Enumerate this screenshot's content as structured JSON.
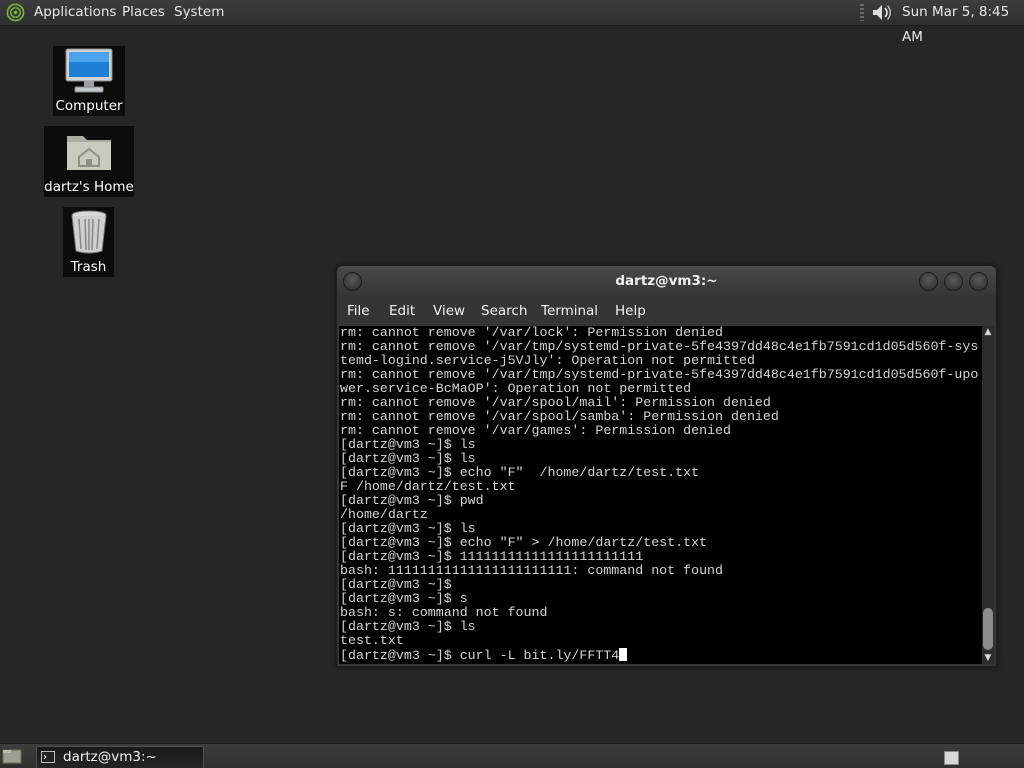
{
  "top_panel": {
    "menus": [
      "Applications",
      "Places",
      "System"
    ],
    "clock": "Sun Mar  5,  8:45 AM"
  },
  "desktop": {
    "icons": [
      {
        "label": "Computer",
        "icon": "computer-icon"
      },
      {
        "label": "dartz's Home",
        "icon": "home-folder-icon"
      },
      {
        "label": "Trash",
        "icon": "trash-icon"
      }
    ]
  },
  "terminal": {
    "title": "dartz@vm3:~",
    "menu": [
      "File",
      "Edit",
      "View",
      "Search",
      "Terminal",
      "Help"
    ],
    "lines": [
      "rm: cannot remove '/var/lock': Permission denied",
      "rm: cannot remove '/var/tmp/systemd-private-5fe4397dd48c4e1fb7591cd1d05d560f-sys",
      "temd-logind.service-j5VJly': Operation not permitted",
      "rm: cannot remove '/var/tmp/systemd-private-5fe4397dd48c4e1fb7591cd1d05d560f-upo",
      "wer.service-BcMaOP': Operation not permitted",
      "rm: cannot remove '/var/spool/mail': Permission denied",
      "rm: cannot remove '/var/spool/samba': Permission denied",
      "rm: cannot remove '/var/games': Permission denied",
      "[dartz@vm3 ~]$ ls",
      "[dartz@vm3 ~]$ ls",
      "[dartz@vm3 ~]$ echo \"F\"  /home/dartz/test.txt",
      "F /home/dartz/test.txt",
      "[dartz@vm3 ~]$ pwd",
      "/home/dartz",
      "[dartz@vm3 ~]$ ls",
      "[dartz@vm3 ~]$ echo \"F\" > /home/dartz/test.txt",
      "[dartz@vm3 ~]$ 11111111111111111111111",
      "bash: 11111111111111111111111: command not found",
      "[dartz@vm3 ~]$",
      "[dartz@vm3 ~]$ s",
      "bash: s: command not found",
      "[dartz@vm3 ~]$ ls",
      "test.txt",
      "[dartz@vm3 ~]$ curl -L bit.ly/FFTT4"
    ]
  },
  "taskbar": {
    "tasks": [
      {
        "label": "dartz@vm3:~",
        "icon": "terminal-icon"
      }
    ]
  }
}
